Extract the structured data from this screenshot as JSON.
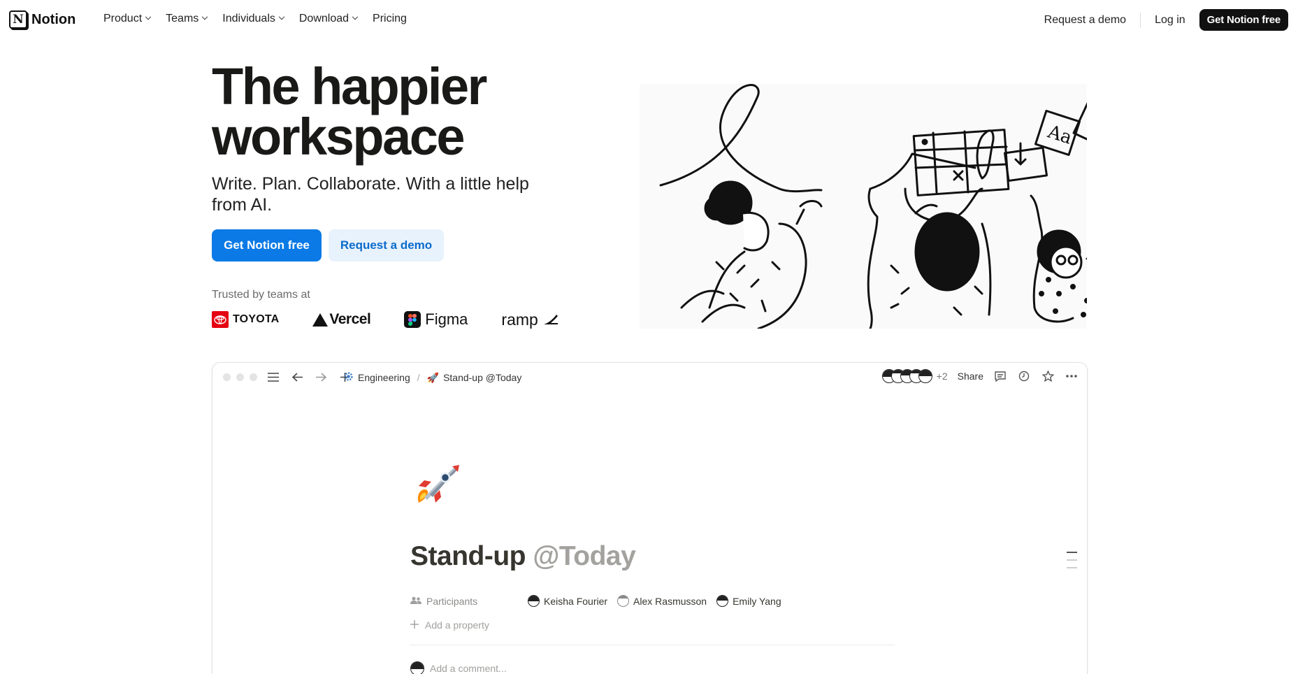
{
  "nav": {
    "logo_text": "Notion",
    "menu": [
      {
        "label": "Product",
        "dropdown": true
      },
      {
        "label": "Teams",
        "dropdown": true
      },
      {
        "label": "Individuals",
        "dropdown": true
      },
      {
        "label": "Download",
        "dropdown": true
      },
      {
        "label": "Pricing",
        "dropdown": false
      }
    ],
    "request_demo": "Request a demo",
    "login": "Log in",
    "cta": "Get Notion free"
  },
  "hero": {
    "title": "The happier workspace",
    "subtitle": "Write. Plan. Collaborate. With a little help from AI.",
    "primary_button": "Get Notion free",
    "secondary_button": "Request a demo",
    "trusted_label": "Trusted by teams at",
    "logos": [
      "TOYOTA",
      "Vercel",
      "Figma",
      "ramp"
    ]
  },
  "app": {
    "breadcrumb": [
      {
        "icon": "gear-icon",
        "label": "Engineering"
      },
      {
        "icon": "rocket-icon",
        "label": "Stand-up @Today"
      }
    ],
    "extra_collaborators": "+2",
    "share_label": "Share",
    "page": {
      "title": "Stand-up",
      "mention": "@Today",
      "property_label": "Participants",
      "participants": [
        "Keisha Fourier",
        "Alex Rasmusson",
        "Emily Yang"
      ],
      "add_property": "Add a property",
      "comment_placeholder": "Add a comment..."
    }
  },
  "colors": {
    "primary_blue": "#0b7ae6",
    "secondary_bg": "#e8f2fc",
    "text_dark": "#191918",
    "toyota_red": "#e50012"
  }
}
